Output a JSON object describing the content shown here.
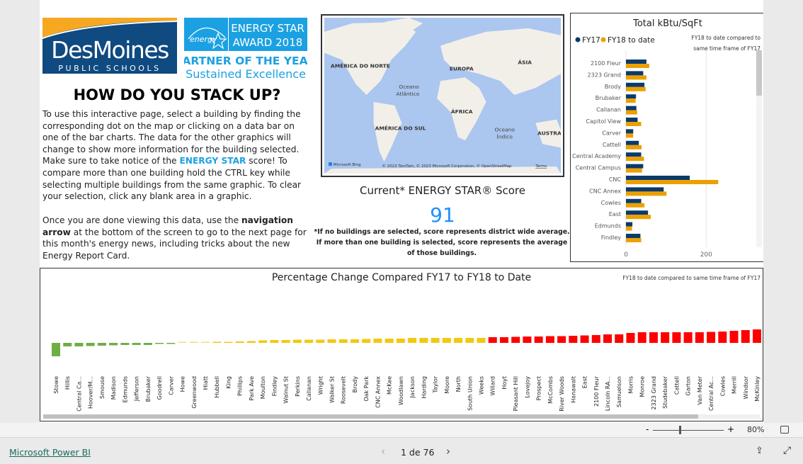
{
  "logos": {
    "dmps": {
      "line1": "DesMoines",
      "line2": "PUBLIC SCHOOLS"
    },
    "energy_star": {
      "mark": "energy",
      "line1": "ENERGY STAR",
      "line2": "AWARD 2018",
      "line3": "PARTNER OF THE YEAR",
      "line4": "Sustained Excellence"
    }
  },
  "heading": "HOW DO YOU STACK UP?",
  "intro": {
    "p1_a": "To use this interactive page, select a building by finding the corresponding dot on the map or clicking on a data bar on one of the bar charts. The data for the other graphics will change to show more information for the building selected. Make sure to take notice of the ",
    "p1_link": "ENERGY STAR",
    "p1_b": " score! To compare more than one building hold the CTRL key while selecting multiple buildings from the same graphic. To clear your selection, click any blank area in a graphic.",
    "p2_a": "Once you are done viewing this data, use the ",
    "p2_bold": "navigation arrow",
    "p2_b": " at the bottom of the screen to go to the next page for this month's energy news, including tricks about the new Energy Report Card."
  },
  "map": {
    "labels": {
      "na": "AMÉRICA DO NORTE",
      "eu": "EUROPA",
      "as": "ÁSIA",
      "atl1": "Oceano",
      "atl2": "Atlântico",
      "af": "ÁFRICA",
      "sa": "AMÉRICA DO SUL",
      "ind1": "Oceano",
      "ind2": "Índico",
      "au": "AUSTRA"
    },
    "attribution": "© 2023 TomTom, © 2023 Microsoft Corporation, © OpenStreetMap",
    "terms": "Terms",
    "bing": "Microsoft Bing",
    "colors": {
      "ocean": "#abc6ef",
      "land": "#f2efe9"
    }
  },
  "score": {
    "title": "Current* ENERGY STAR® Score",
    "value": "91",
    "note": "*If no buildings are selected, score represents district wide average. If more than one building is selected, score represents the average of those buildings."
  },
  "chart_data": [
    {
      "type": "bar",
      "orientation": "horizontal",
      "title": "Total kBtu/SqFt",
      "subtitle": "FY18 to date compared to same time frame of FY17",
      "legend_position": "top-left",
      "categories": [
        "2100 Fleur",
        "2323 Grand",
        "Brody",
        "Brubaker",
        "Callanan",
        "Capitol View",
        "Carver",
        "Cattell",
        "Central Academy",
        "Central Campus",
        "CNC",
        "CNC Annex",
        "Cowles",
        "East",
        "Edmunds",
        "Findley"
      ],
      "series": [
        {
          "name": "FY17",
          "color": "#0b3a6b",
          "values": [
            51,
            43,
            46,
            25,
            26,
            29,
            18,
            32,
            38,
            43,
            159,
            94,
            38,
            55,
            16,
            36
          ]
        },
        {
          "name": "FY18 to date",
          "color": "#eca000",
          "values": [
            58,
            51,
            49,
            24,
            28,
            38,
            18,
            39,
            45,
            40,
            230,
            101,
            46,
            62,
            15,
            38
          ]
        }
      ],
      "xlim": [
        0,
        300
      ],
      "x_ticks": [
        "0",
        "200"
      ],
      "grid": true
    },
    {
      "type": "bar",
      "title": "Percentage Change Compared FY17 to FY18 to Date",
      "subtitle": "FY18 to date compared to same time frame of FY17",
      "categories": [
        "Stowe",
        "Hillis",
        "Central Ca...",
        "Hoover/M...",
        "Smouse",
        "Madison",
        "Edmunds",
        "Jefferson",
        "Brubaker",
        "Goodrell",
        "Carver",
        "Howe",
        "Greenwood",
        "Hiatt",
        "Hubbell",
        "King",
        "Phillips",
        "Park Ave",
        "Moulton",
        "Findley",
        "Walnut St",
        "Perkins",
        "Callanan",
        "Wright",
        "Walker St",
        "Roosevelt",
        "Brody",
        "Oak Park",
        "CNC Annex",
        "McKee",
        "Woodlawn",
        "Jackson",
        "Harding",
        "Taylor",
        "Moore",
        "North",
        "South Union",
        "Weeks",
        "Willard",
        "Hoyt",
        "Pleasant Hill",
        "Lovejoy",
        "Prospect",
        "McCombs",
        "River Woods",
        "Hanawalt",
        "East",
        "2100 Fleur",
        "Lincoln RA...",
        "Samuelson",
        "Morris",
        "Monroe",
        "2323 Grand",
        "Studebaker",
        "Cattell",
        "Garton",
        "Van Meter",
        "Central Ac...",
        "Cowles",
        "Merrill",
        "Windsor",
        "McKinley"
      ],
      "values": [
        -19,
        -5,
        -5,
        -4.5,
        -4,
        -3.5,
        -3,
        -3,
        -3,
        -1,
        -1,
        0.5,
        0.5,
        0.7,
        1,
        1.5,
        2,
        2.5,
        3.5,
        4,
        4,
        4.5,
        4.5,
        4.5,
        5,
        5,
        5,
        5.5,
        6,
        6,
        6,
        7,
        7,
        7,
        7,
        7,
        7,
        7,
        8,
        8,
        8.5,
        9,
        9,
        9.5,
        9.5,
        10,
        10.5,
        11,
        12,
        12,
        14,
        15,
        15,
        15,
        15,
        15,
        15,
        15.5,
        16,
        17,
        18,
        19
      ],
      "colors": {
        "negative": "#70ad47",
        "near_zero": "#f7dd7a",
        "moderate": "#f2c811",
        "high": "#fe0000"
      }
    }
  ],
  "toolbar": {
    "zoom_minus": "-",
    "zoom_plus": "+",
    "zoom_level": "80%",
    "zoom_fraction": 0.5
  },
  "footer": {
    "brand": "Microsoft Power BI",
    "page": "1 de 76"
  }
}
